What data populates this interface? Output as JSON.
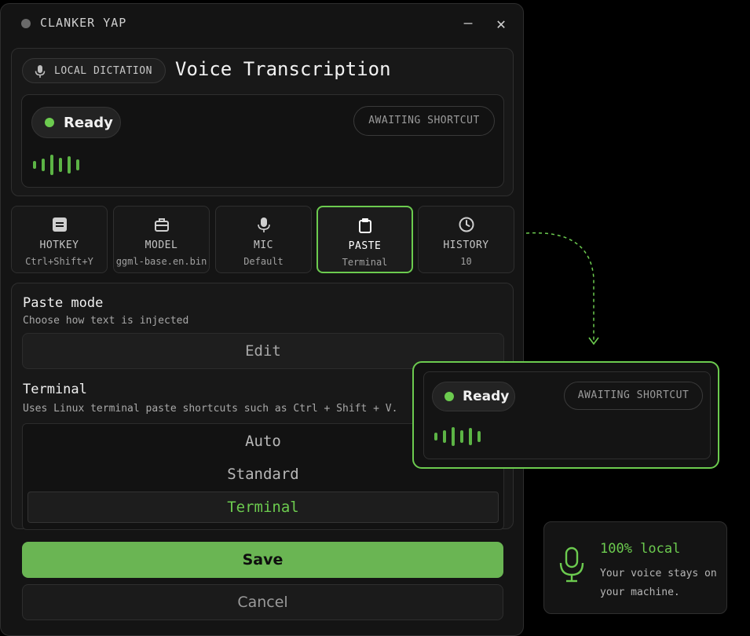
{
  "window": {
    "title": "CLANKER YAP",
    "minimize_glyph": "—",
    "close_glyph": "✕"
  },
  "header": {
    "chip_label": "LOCAL DICTATION",
    "title": "Voice Transcription"
  },
  "status": {
    "state": "Ready",
    "badge": "AWAITING SHORTCUT",
    "state_color": "#6ccb4f"
  },
  "tabs": [
    {
      "label": "HOTKEY",
      "value": "Ctrl+Shift+Y",
      "icon": "keyboard-icon",
      "active": false
    },
    {
      "label": "MODEL",
      "value": "ggml-base.en.bin",
      "icon": "briefcase-icon",
      "active": false
    },
    {
      "label": "MIC",
      "value": "Default",
      "icon": "microphone-icon",
      "active": false
    },
    {
      "label": "PASTE",
      "value": "Terminal",
      "icon": "clipboard-icon",
      "active": true
    },
    {
      "label": "HISTORY",
      "value": "10",
      "icon": "clock-icon",
      "active": false
    }
  ],
  "paste_mode": {
    "title": "Paste mode",
    "subtitle": "Choose how text is injected",
    "edit_label": "Edit",
    "selected_title": "Terminal",
    "selected_description": "Uses Linux terminal paste shortcuts such as Ctrl + Shift + V.",
    "options": [
      "Auto",
      "Standard",
      "Terminal"
    ],
    "selected_option": "Terminal"
  },
  "actions": {
    "save": "Save",
    "cancel": "Cancel"
  },
  "overlay": {
    "state": "Ready",
    "badge": "AWAITING SHORTCUT"
  },
  "local_card": {
    "title": "100% local",
    "body": "Your voice stays on your machine."
  },
  "colors": {
    "accent": "#6ccb4f",
    "background": "#000000",
    "panel": "#181818"
  }
}
